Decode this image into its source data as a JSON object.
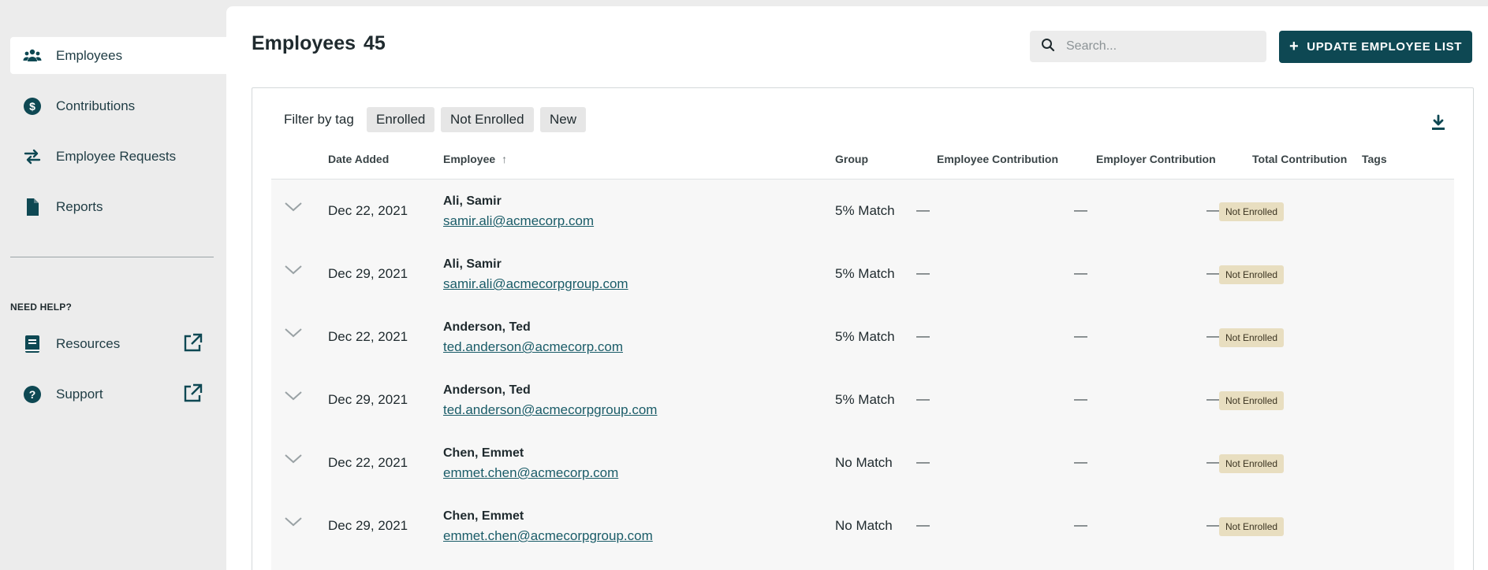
{
  "sidebar": {
    "items": [
      {
        "label": "Employees",
        "icon": "people-icon"
      },
      {
        "label": "Contributions",
        "icon": "dollar-icon"
      },
      {
        "label": "Employee Requests",
        "icon": "swap-arrows-icon"
      },
      {
        "label": "Reports",
        "icon": "document-icon"
      }
    ],
    "help_heading": "NEED HELP?",
    "help_items": [
      {
        "label": "Resources",
        "icon": "book-icon"
      },
      {
        "label": "Support",
        "icon": "question-icon"
      }
    ]
  },
  "header": {
    "title": "Employees",
    "count": "45",
    "search_placeholder": "Search...",
    "search_value": "",
    "update_button_label": "UPDATE EMPLOYEE LIST"
  },
  "filters": {
    "label": "Filter by tag",
    "chips": [
      "Enrolled",
      "Not Enrolled",
      "New"
    ]
  },
  "table": {
    "columns": {
      "date_added": "Date Added",
      "employee": "Employee",
      "group": "Group",
      "employee_contribution": "Employee Contribution",
      "employer_contribution": "Employer Contribution",
      "total_contribution": "Total Contribution",
      "tags": "Tags"
    },
    "sort_indicator": "↑",
    "rows": [
      {
        "date": "Dec 22, 2021",
        "name": "Ali, Samir",
        "email": "samir.ali@acmecorp.com",
        "group": "5% Match",
        "employee_contribution": "—",
        "employer_contribution": "—",
        "total_contribution": "—",
        "tag": "Not Enrolled"
      },
      {
        "date": "Dec 29, 2021",
        "name": "Ali, Samir",
        "email": "samir.ali@acmecorpgroup.com",
        "group": "5% Match",
        "employee_contribution": "—",
        "employer_contribution": "—",
        "total_contribution": "—",
        "tag": "Not Enrolled"
      },
      {
        "date": "Dec 22, 2021",
        "name": "Anderson, Ted",
        "email": "ted.anderson@acmecorp.com",
        "group": "5% Match",
        "employee_contribution": "—",
        "employer_contribution": "—",
        "total_contribution": "—",
        "tag": "Not Enrolled"
      },
      {
        "date": "Dec 29, 2021",
        "name": "Anderson, Ted",
        "email": "ted.anderson@acmecorpgroup.com",
        "group": "5% Match",
        "employee_contribution": "—",
        "employer_contribution": "—",
        "total_contribution": "—",
        "tag": "Not Enrolled"
      },
      {
        "date": "Dec 22, 2021",
        "name": "Chen, Emmet",
        "email": "emmet.chen@acmecorp.com",
        "group": "No Match",
        "employee_contribution": "—",
        "employer_contribution": "—",
        "total_contribution": "—",
        "tag": "Not Enrolled"
      },
      {
        "date": "Dec 29, 2021",
        "name": "Chen, Emmet",
        "email": "emmet.chen@acmecorpgroup.com",
        "group": "No Match",
        "employee_contribution": "—",
        "employer_contribution": "—",
        "total_contribution": "—",
        "tag": "Not Enrolled"
      }
    ]
  },
  "colors": {
    "accent": "#0e4853",
    "link": "#1a5c68",
    "tag_bg": "#e8dec0",
    "sidebar_bg": "#ececec"
  }
}
